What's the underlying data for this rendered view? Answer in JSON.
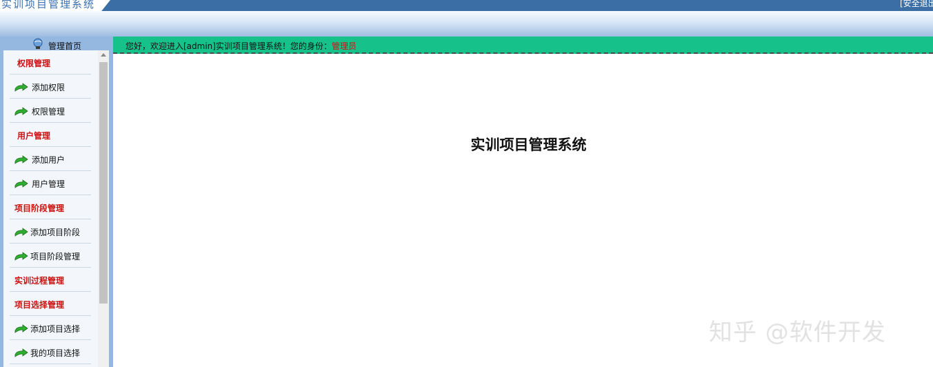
{
  "header": {
    "app_title": "实训项目管理系统",
    "logout_label": "[安全退出]"
  },
  "sidebar": {
    "home_label": "管理首页",
    "items": [
      {
        "label": "权限管理",
        "type": "category"
      },
      {
        "label": "添加权限",
        "type": "link",
        "icon": "green-arrow-icon"
      },
      {
        "label": "权限管理",
        "type": "link",
        "icon": "green-arrow-icon"
      },
      {
        "label": "用户管理",
        "type": "category"
      },
      {
        "label": "添加用户",
        "type": "link",
        "icon": "green-arrow-icon"
      },
      {
        "label": "用户管理",
        "type": "link",
        "icon": "green-arrow-icon"
      },
      {
        "label": "项目阶段管理",
        "type": "category"
      },
      {
        "label": "添加项目阶段",
        "type": "link",
        "icon": "green-arrow-icon"
      },
      {
        "label": "项目阶段管理",
        "type": "link",
        "icon": "green-arrow-icon"
      },
      {
        "label": "实训过程管理",
        "type": "category"
      },
      {
        "label": "项目选择管理",
        "type": "category"
      },
      {
        "label": "添加项目选择",
        "type": "link",
        "icon": "green-arrow-icon"
      },
      {
        "label": "我的项目选择",
        "type": "link",
        "icon": "green-arrow-icon"
      }
    ]
  },
  "welcome_bar": {
    "text": "您好，欢迎进入[admin]实训项目管理系统！您的身份：",
    "role": "管理员"
  },
  "main": {
    "heading": "实训项目管理系统"
  },
  "watermark": "知乎 @软件开发",
  "colors": {
    "topbar": "#3c6ea6",
    "welcome_bar": "#16c28a",
    "category_text": "#cc1111",
    "sidebar_bg": "#94b8e0"
  }
}
